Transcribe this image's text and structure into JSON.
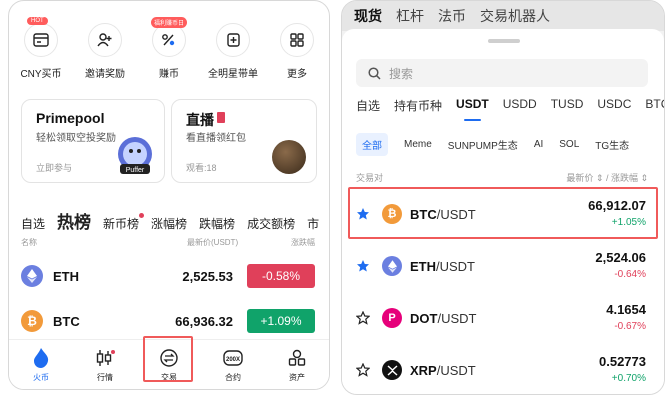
{
  "colors": {
    "accent": "#1e6cf0",
    "up": "#10a36a",
    "down": "#e0405a",
    "highlight": "#f05a5a"
  },
  "left": {
    "quick_actions": [
      {
        "label": "CNY买币",
        "badge": "HOT",
        "icon": "card-icon"
      },
      {
        "label": "邀请奖励",
        "badge": "",
        "icon": "add-user-icon"
      },
      {
        "label": "赚币",
        "badge": "福利赚币日",
        "icon": "percent-icon"
      },
      {
        "label": "全明星带单",
        "badge": "",
        "icon": "copy-trade-icon"
      },
      {
        "label": "更多",
        "badge": "",
        "icon": "grid-icon"
      }
    ],
    "cards": [
      {
        "title": "Primepool",
        "subtitle": "轻松领取空投奖励",
        "footer": "立即参与",
        "image": "Puffer"
      },
      {
        "title": "直播",
        "subtitle": "看直播领红包",
        "footer": "观看:18"
      }
    ],
    "market_tabs": [
      "自选",
      "热榜",
      "新币榜",
      "涨幅榜",
      "跌幅榜",
      "成交额榜",
      "市"
    ],
    "headers": {
      "name": "名称",
      "price": "最新价(USDT)",
      "change": "涨跌幅"
    },
    "rows": [
      {
        "symbol": "ETH",
        "price": "2,525.53",
        "change": "-0.58%",
        "dir": "down"
      },
      {
        "symbol": "BTC",
        "price": "66,936.32",
        "change": "+1.09%",
        "dir": "up"
      }
    ],
    "nav": [
      {
        "label": "火币",
        "icon": "flame-icon"
      },
      {
        "label": "行情",
        "icon": "candlestick-icon"
      },
      {
        "label": "交易",
        "icon": "trade-swap-icon"
      },
      {
        "label": "合约",
        "icon": "contract-icon"
      },
      {
        "label": "资产",
        "icon": "assets-icon"
      }
    ]
  },
  "right": {
    "top_tabs": [
      "现货",
      "杠杆",
      "法币",
      "交易机器人"
    ],
    "search_placeholder": "搜索",
    "quote_tabs": [
      "自选",
      "持有币种",
      "USDT",
      "USDD",
      "TUSD",
      "USDC",
      "BTC"
    ],
    "filter_tabs": [
      "全部",
      "Meme",
      "SUNPUMP生态",
      "AI",
      "SOL",
      "TG生态"
    ],
    "headers": {
      "pair": "交易对",
      "price_change": "最新价 ⇕ / 涨跌幅 ⇕"
    },
    "rows": [
      {
        "base": "BTC",
        "quote": "/USDT",
        "price": "66,912.07",
        "change": "+1.05%",
        "dir": "up",
        "starred": true
      },
      {
        "base": "ETH",
        "quote": "/USDT",
        "price": "2,524.06",
        "change": "-0.64%",
        "dir": "down",
        "starred": true
      },
      {
        "base": "DOT",
        "quote": "/USDT",
        "price": "4.1654",
        "change": "-0.67%",
        "dir": "down",
        "starred": false
      },
      {
        "base": "XRP",
        "quote": "/USDT",
        "price": "0.52773",
        "change": "+0.70%",
        "dir": "up",
        "starred": false
      }
    ]
  }
}
